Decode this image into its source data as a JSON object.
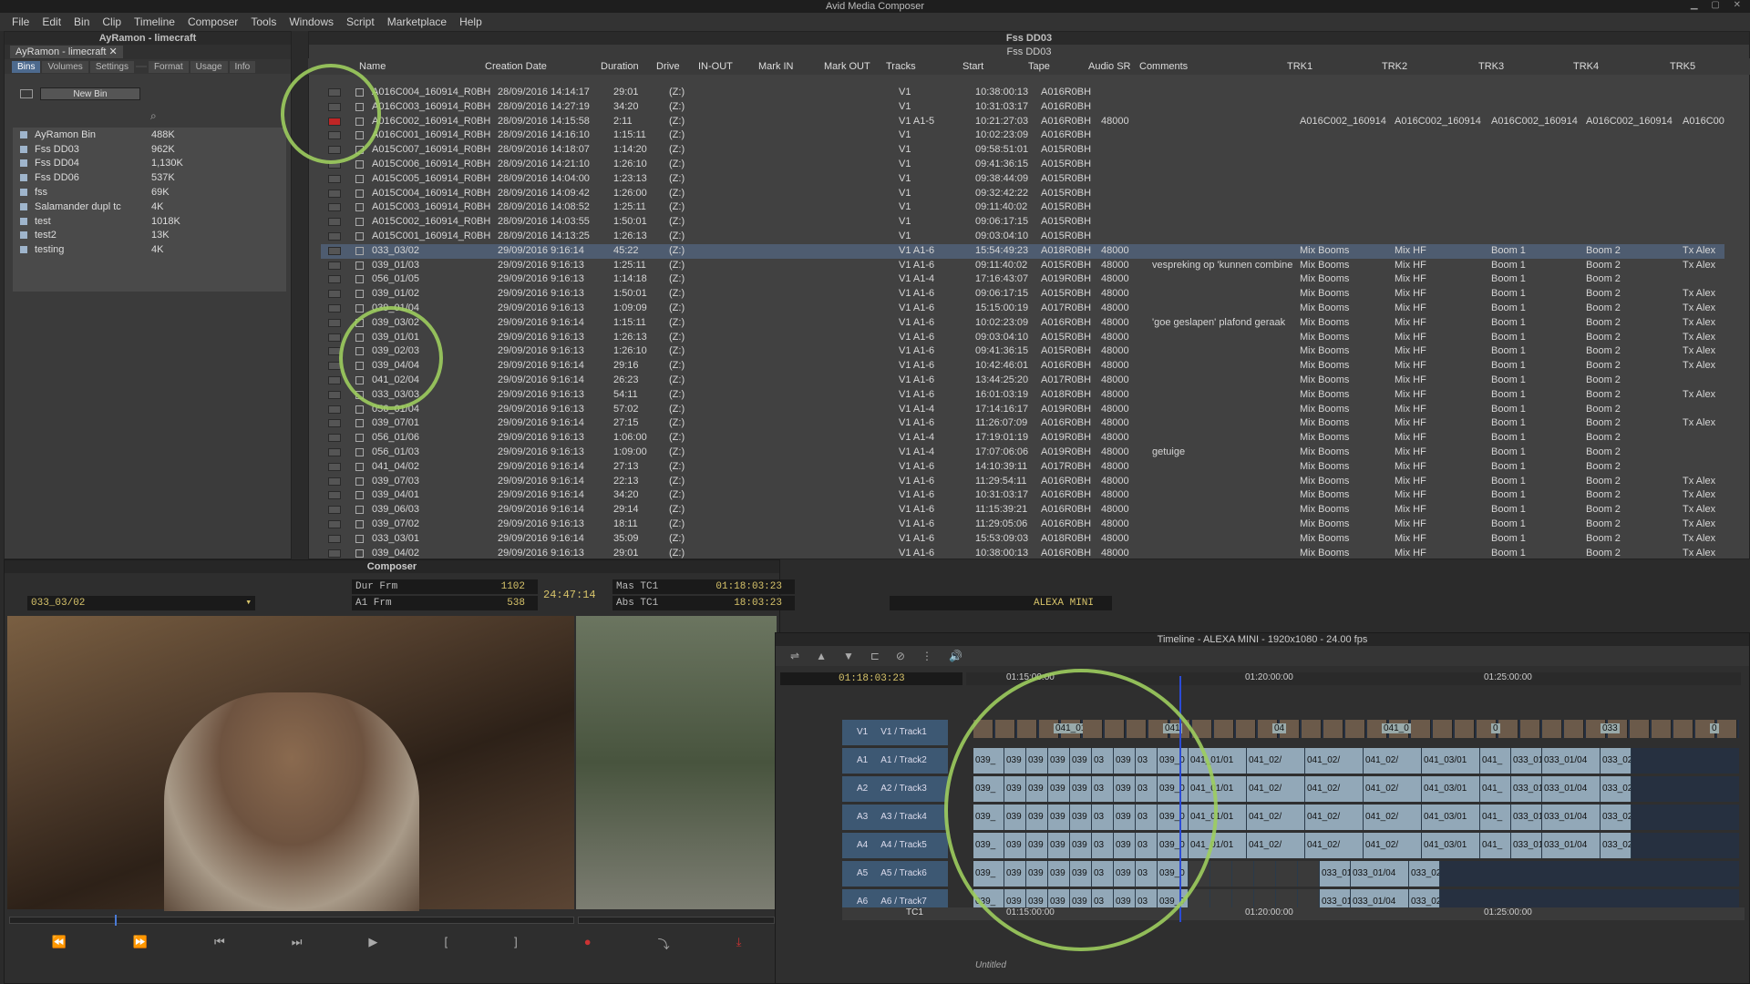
{
  "app_title": "Avid Media Composer",
  "menu": [
    "File",
    "Edit",
    "Bin",
    "Clip",
    "Timeline",
    "Composer",
    "Tools",
    "Windows",
    "Script",
    "Marketplace",
    "Help"
  ],
  "project": {
    "title": "AyRamon - limecraft",
    "tab_label": "AyRamon - limecraft",
    "tabs": [
      "Bins",
      "Volumes",
      "Settings",
      "",
      "Format",
      "Usage",
      "Info"
    ],
    "new_bin_label": "New Bin",
    "bins": [
      {
        "name": "AyRamon Bin",
        "size": "488K"
      },
      {
        "name": "Fss DD03",
        "size": "962K"
      },
      {
        "name": "Fss DD04",
        "size": "1,130K"
      },
      {
        "name": "Fss DD06",
        "size": "537K"
      },
      {
        "name": "fss",
        "size": "69K"
      },
      {
        "name": "Salamander dupl tc",
        "size": "4K"
      },
      {
        "name": "test",
        "size": "1018K"
      },
      {
        "name": "test2",
        "size": "13K"
      },
      {
        "name": "testing",
        "size": "4K"
      }
    ]
  },
  "bin": {
    "window_title": "Fss DD03",
    "tab_label": "Fss DD03",
    "columns": [
      "Name",
      "Creation Date",
      "Duration",
      "Drive",
      "IN-OUT",
      "Mark IN",
      "Mark OUT",
      "Tracks",
      "Start",
      "Tape",
      "Audio SR",
      "Comments",
      "TRK1",
      "TRK2",
      "TRK3",
      "TRK4",
      "TRK5"
    ],
    "rows": [
      {
        "name": "A016C004_160914_R0BH",
        "date": "28/09/2016 14:14:17",
        "dur": "29:01",
        "drive": "(Z:)",
        "tracks": "V1",
        "start": "10:38:00:13",
        "tape": "A016R0BH"
      },
      {
        "name": "A016C003_160914_R0BH",
        "date": "28/09/2016 14:27:19",
        "dur": "34:20",
        "drive": "(Z:)",
        "tracks": "V1",
        "start": "10:31:03:17",
        "tape": "A016R0BH"
      },
      {
        "name": "A016C002_160914_R0BH",
        "date": "28/09/2016 14:15:58",
        "dur": "2:11",
        "drive": "(Z:)",
        "tracks": "V1 A1-5",
        "start": "10:21:27:03",
        "tape": "A016R0BH",
        "sr": "48000",
        "t1": "A016C002_160914",
        "t2": "A016C002_160914",
        "t3": "A016C002_160914",
        "t4": "A016C002_160914",
        "t5": "A016C00",
        "red": true
      },
      {
        "name": "A016C001_160914_R0BH",
        "date": "28/09/2016 14:16:10",
        "dur": "1:15:11",
        "drive": "(Z:)",
        "tracks": "V1",
        "start": "10:02:23:09",
        "tape": "A016R0BH"
      },
      {
        "name": "A015C007_160914_R0BH",
        "date": "28/09/2016 14:18:07",
        "dur": "1:14:20",
        "drive": "(Z:)",
        "tracks": "V1",
        "start": "09:58:51:01",
        "tape": "A015R0BH"
      },
      {
        "name": "A015C006_160914_R0BH",
        "date": "28/09/2016 14:21:10",
        "dur": "1:26:10",
        "drive": "(Z:)",
        "tracks": "V1",
        "start": "09:41:36:15",
        "tape": "A015R0BH"
      },
      {
        "name": "A015C005_160914_R0BH",
        "date": "28/09/2016 14:04:00",
        "dur": "1:23:13",
        "drive": "(Z:)",
        "tracks": "V1",
        "start": "09:38:44:09",
        "tape": "A015R0BH"
      },
      {
        "name": "A015C004_160914_R0BH",
        "date": "28/09/2016 14:09:42",
        "dur": "1:26:00",
        "drive": "(Z:)",
        "tracks": "V1",
        "start": "09:32:42:22",
        "tape": "A015R0BH"
      },
      {
        "name": "A015C003_160914_R0BH",
        "date": "28/09/2016 14:08:52",
        "dur": "1:25:11",
        "drive": "(Z:)",
        "tracks": "V1",
        "start": "09:11:40:02",
        "tape": "A015R0BH"
      },
      {
        "name": "A015C002_160914_R0BH",
        "date": "28/09/2016 14:03:55",
        "dur": "1:50:01",
        "drive": "(Z:)",
        "tracks": "V1",
        "start": "09:06:17:15",
        "tape": "A015R0BH"
      },
      {
        "name": "A015C001_160914_R0BH",
        "date": "28/09/2016 14:13:25",
        "dur": "1:26:13",
        "drive": "(Z:)",
        "tracks": "V1",
        "start": "09:03:04:10",
        "tape": "A015R0BH"
      },
      {
        "name": "033_03/02",
        "date": "29/09/2016 9:16:14",
        "dur": "45:22",
        "drive": "(Z:)",
        "tracks": "V1 A1-6",
        "start": "15:54:49:23",
        "tape": "A018R0BH",
        "sr": "48000",
        "t1": "Mix Booms",
        "t2": "Mix HF",
        "t3": "Boom 1",
        "t4": "Boom 2",
        "t5": "Tx Alex",
        "sel": true
      },
      {
        "name": "039_01/03",
        "date": "29/09/2016 9:16:13",
        "dur": "1:25:11",
        "drive": "(Z:)",
        "tracks": "V1 A1-6",
        "start": "09:11:40:02",
        "tape": "A015R0BH",
        "sr": "48000",
        "comment": "vespreking op 'kunnen combine",
        "t1": "Mix Booms",
        "t2": "Mix HF",
        "t3": "Boom 1",
        "t4": "Boom 2",
        "t5": "Tx Alex"
      },
      {
        "name": "056_01/05",
        "date": "29/09/2016 9:16:13",
        "dur": "1:14:18",
        "drive": "(Z:)",
        "tracks": "V1 A1-4",
        "start": "17:16:43:07",
        "tape": "A019R0BH",
        "sr": "48000",
        "t1": "Mix Booms",
        "t2": "Mix HF",
        "t3": "Boom 1",
        "t4": "Boom 2",
        "t5": ""
      },
      {
        "name": "039_01/02",
        "date": "29/09/2016 9:16:13",
        "dur": "1:50:01",
        "drive": "(Z:)",
        "tracks": "V1 A1-6",
        "start": "09:06:17:15",
        "tape": "A015R0BH",
        "sr": "48000",
        "t1": "Mix Booms",
        "t2": "Mix HF",
        "t3": "Boom 1",
        "t4": "Boom 2",
        "t5": "Tx Alex"
      },
      {
        "name": "039_01/04",
        "date": "29/09/2016 9:16:13",
        "dur": "1:09:09",
        "drive": "(Z:)",
        "tracks": "V1 A1-6",
        "start": "15:15:00:19",
        "tape": "A017R0BH",
        "sr": "48000",
        "t1": "Mix Booms",
        "t2": "Mix HF",
        "t3": "Boom 1",
        "t4": "Boom 2",
        "t5": "Tx Alex"
      },
      {
        "name": "039_03/02",
        "date": "29/09/2016 9:16:14",
        "dur": "1:15:11",
        "drive": "(Z:)",
        "tracks": "V1 A1-6",
        "start": "10:02:23:09",
        "tape": "A016R0BH",
        "sr": "48000",
        "comment": "'goe geslapen' plafond geraak",
        "t1": "Mix Booms",
        "t2": "Mix HF",
        "t3": "Boom 1",
        "t4": "Boom 2",
        "t5": "Tx Alex"
      },
      {
        "name": "039_01/01",
        "date": "29/09/2016 9:16:13",
        "dur": "1:26:13",
        "drive": "(Z:)",
        "tracks": "V1 A1-6",
        "start": "09:03:04:10",
        "tape": "A015R0BH",
        "sr": "48000",
        "t1": "Mix Booms",
        "t2": "Mix HF",
        "t3": "Boom 1",
        "t4": "Boom 2",
        "t5": "Tx Alex"
      },
      {
        "name": "039_02/03",
        "date": "29/09/2016 9:16:13",
        "dur": "1:26:10",
        "drive": "(Z:)",
        "tracks": "V1 A1-6",
        "start": "09:41:36:15",
        "tape": "A015R0BH",
        "sr": "48000",
        "t1": "Mix Booms",
        "t2": "Mix HF",
        "t3": "Boom 1",
        "t4": "Boom 2",
        "t5": "Tx Alex"
      },
      {
        "name": "039_04/04",
        "date": "29/09/2016 9:16:14",
        "dur": "29:16",
        "drive": "(Z:)",
        "tracks": "V1 A1-6",
        "start": "10:42:46:01",
        "tape": "A016R0BH",
        "sr": "48000",
        "t1": "Mix Booms",
        "t2": "Mix HF",
        "t3": "Boom 1",
        "t4": "Boom 2",
        "t5": "Tx Alex"
      },
      {
        "name": "041_02/04",
        "date": "29/09/2016 9:16:14",
        "dur": "26:23",
        "drive": "(Z:)",
        "tracks": "V1 A1-6",
        "start": "13:44:25:20",
        "tape": "A017R0BH",
        "sr": "48000",
        "t1": "Mix Booms",
        "t2": "Mix HF",
        "t3": "Boom 1",
        "t4": "Boom 2",
        "t5": ""
      },
      {
        "name": "033_03/03",
        "date": "29/09/2016 9:16:13",
        "dur": "54:11",
        "drive": "(Z:)",
        "tracks": "V1 A1-6",
        "start": "16:01:03:19",
        "tape": "A018R0BH",
        "sr": "48000",
        "t1": "Mix Booms",
        "t2": "Mix HF",
        "t3": "Boom 1",
        "t4": "Boom 2",
        "t5": "Tx Alex"
      },
      {
        "name": "056_01/04",
        "date": "29/09/2016 9:16:13",
        "dur": "57:02",
        "drive": "(Z:)",
        "tracks": "V1 A1-4",
        "start": "17:14:16:17",
        "tape": "A019R0BH",
        "sr": "48000",
        "t1": "Mix Booms",
        "t2": "Mix HF",
        "t3": "Boom 1",
        "t4": "Boom 2",
        "t5": ""
      },
      {
        "name": "039_07/01",
        "date": "29/09/2016 9:16:14",
        "dur": "27:15",
        "drive": "(Z:)",
        "tracks": "V1 A1-6",
        "start": "11:26:07:09",
        "tape": "A016R0BH",
        "sr": "48000",
        "t1": "Mix Booms",
        "t2": "Mix HF",
        "t3": "Boom 1",
        "t4": "Boom 2",
        "t5": "Tx Alex"
      },
      {
        "name": "056_01/06",
        "date": "29/09/2016 9:16:13",
        "dur": "1:06:00",
        "drive": "(Z:)",
        "tracks": "V1 A1-4",
        "start": "17:19:01:19",
        "tape": "A019R0BH",
        "sr": "48000",
        "t1": "Mix Booms",
        "t2": "Mix HF",
        "t3": "Boom 1",
        "t4": "Boom 2",
        "t5": ""
      },
      {
        "name": "056_01/03",
        "date": "29/09/2016 9:16:13",
        "dur": "1:09:00",
        "drive": "(Z:)",
        "tracks": "V1 A1-4",
        "start": "17:07:06:06",
        "tape": "A019R0BH",
        "sr": "48000",
        "comment": "getuige",
        "t1": "Mix Booms",
        "t2": "Mix HF",
        "t3": "Boom 1",
        "t4": "Boom 2",
        "t5": ""
      },
      {
        "name": "041_04/02",
        "date": "29/09/2016 9:16:14",
        "dur": "27:13",
        "drive": "(Z:)",
        "tracks": "V1 A1-6",
        "start": "14:10:39:11",
        "tape": "A017R0BH",
        "sr": "48000",
        "t1": "Mix Booms",
        "t2": "Mix HF",
        "t3": "Boom 1",
        "t4": "Boom 2",
        "t5": ""
      },
      {
        "name": "039_07/03",
        "date": "29/09/2016 9:16:14",
        "dur": "22:13",
        "drive": "(Z:)",
        "tracks": "V1 A1-6",
        "start": "11:29:54:11",
        "tape": "A016R0BH",
        "sr": "48000",
        "t1": "Mix Booms",
        "t2": "Mix HF",
        "t3": "Boom 1",
        "t4": "Boom 2",
        "t5": "Tx Alex"
      },
      {
        "name": "039_04/01",
        "date": "29/09/2016 9:16:14",
        "dur": "34:20",
        "drive": "(Z:)",
        "tracks": "V1 A1-6",
        "start": "10:31:03:17",
        "tape": "A016R0BH",
        "sr": "48000",
        "t1": "Mix Booms",
        "t2": "Mix HF",
        "t3": "Boom 1",
        "t4": "Boom 2",
        "t5": "Tx Alex"
      },
      {
        "name": "039_06/03",
        "date": "29/09/2016 9:16:14",
        "dur": "29:14",
        "drive": "(Z:)",
        "tracks": "V1 A1-6",
        "start": "11:15:39:21",
        "tape": "A016R0BH",
        "sr": "48000",
        "t1": "Mix Booms",
        "t2": "Mix HF",
        "t3": "Boom 1",
        "t4": "Boom 2",
        "t5": "Tx Alex"
      },
      {
        "name": "039_07/02",
        "date": "29/09/2016 9:16:13",
        "dur": "18:11",
        "drive": "(Z:)",
        "tracks": "V1 A1-6",
        "start": "11:29:05:06",
        "tape": "A016R0BH",
        "sr": "48000",
        "t1": "Mix Booms",
        "t2": "Mix HF",
        "t3": "Boom 1",
        "t4": "Boom 2",
        "t5": "Tx Alex"
      },
      {
        "name": "033_03/01",
        "date": "29/09/2016 9:16:14",
        "dur": "35:09",
        "drive": "(Z:)",
        "tracks": "V1 A1-6",
        "start": "15:53:09:03",
        "tape": "A018R0BH",
        "sr": "48000",
        "t1": "Mix Booms",
        "t2": "Mix HF",
        "t3": "Boom 1",
        "t4": "Boom 2",
        "t5": "Tx Alex"
      },
      {
        "name": "039_04/02",
        "date": "29/09/2016 9:16:13",
        "dur": "29:01",
        "drive": "(Z:)",
        "tracks": "V1 A1-6",
        "start": "10:38:00:13",
        "tape": "A016R0BH",
        "sr": "48000",
        "t1": "Mix Booms",
        "t2": "Mix HF",
        "t3": "Boom 1",
        "t4": "Boom 2",
        "t5": "Tx Alex"
      }
    ],
    "overflow_rows": [
      {
        "t1": "Mix Booms",
        "t2": "Mix HF",
        "t3": "Boom 1",
        "t4": "Boom 2",
        "t5": ""
      },
      {
        "t1": "Mix Booms",
        "t2": "Mix HF",
        "t3": "Boom 1",
        "t4": "Boom 2",
        "t5": ""
      },
      {
        "t1": "Mix Booms",
        "t2": "Mix HF",
        "t3": "Boom 1",
        "t4": "Boom 2",
        "t5": ""
      },
      {
        "t1": "Mix Booms",
        "t2": "Mix HF",
        "t3": "Boom 1",
        "t4": "Boom 2",
        "t5": ""
      },
      {
        "t1": "Mix Booms",
        "t2": "Mix HF",
        "t3": "Boom 1",
        "t4": "Boom 2",
        "t5": "Tx Alex"
      },
      {
        "t1": "Mix Booms",
        "t2": "Mix HF",
        "t3": "Boom 1",
        "t4": "Boom 2",
        "t5": "Tx Alex"
      }
    ]
  },
  "composer": {
    "title": "Composer",
    "clip_name": "033_03/02",
    "dur_label": "Dur Frm",
    "dur_value": "1102",
    "a1_label": "A1 Frm",
    "a1_value": "538",
    "center_tc": "24:47:14",
    "mas_label": "Mas TC1",
    "mas_value": "01:18:03:23",
    "abs_label": "Abs TC1",
    "abs_value": "18:03:23",
    "sequence_name": "ALEXA MINI"
  },
  "timeline": {
    "title": "Timeline - ALEXA MINI - 1920x1080 - 24.00 fps",
    "position_tc": "01:18:03:23",
    "ruler": [
      "01:15:00:00",
      "01:20:00:00",
      "01:25:00:00"
    ],
    "tracks": [
      {
        "id": "V1",
        "name": "V1 / Track1"
      },
      {
        "id": "A1",
        "name": "A1 / Track2"
      },
      {
        "id": "A2",
        "name": "A2 / Track3"
      },
      {
        "id": "A3",
        "name": "A3 / Track4"
      },
      {
        "id": "A4",
        "name": "A4 / Track5"
      },
      {
        "id": "A5",
        "name": "A5 / Track6"
      },
      {
        "id": "A6",
        "name": "A6 / Track7"
      }
    ],
    "tc_track_label": "TC1",
    "v1_labels": [
      "041_01",
      "041",
      "04",
      "041_0",
      "0",
      "033",
      "0"
    ],
    "audio_clips": [
      "039_",
      "039",
      "039",
      "039",
      "039",
      "03",
      "039",
      "03",
      "039_0",
      "041_01/01",
      "041_02/",
      "041_02/",
      "041_02/",
      "041_03/01",
      "041_",
      "033_01",
      "033_01/04",
      "033_02"
    ],
    "audio_clips_a5": [
      "039_",
      "039",
      "039",
      "039",
      "039",
      "03",
      "039",
      "03",
      "039_0",
      "",
      "",
      "",
      "",
      "",
      "",
      "033_01",
      "033_01/04",
      "033_02"
    ],
    "footer_label": "Untitled",
    "accent": "#9dcd5e"
  }
}
